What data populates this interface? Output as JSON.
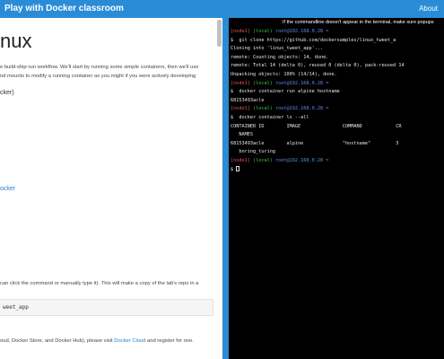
{
  "topbar": {
    "title": "Play with Docker classroom",
    "about": "About"
  },
  "lesson": {
    "heading": "nux",
    "intro_lines": [
      "e build-ship-run workflow. We'll start by running some simple containers, then we'll use",
      "nd mounts to modify a running container as you might if you were actively developing"
    ],
    "cker_text": "cker)",
    "link_docker": "ocker",
    "click_text": "can click the command or manually type it). This will make a copy of the lab's repo in a",
    "code": "weet_app",
    "cloud_text_pre": "oud, Docker Store, and Docker Hub), please visit ",
    "cloud_link": "Docker Cloud",
    "cloud_text_post": " and register for one."
  },
  "terminal": {
    "note": "If the commandline doesn't appear in the terminal, make sure popups",
    "node_label": "[node1]",
    "local_label": "(local)",
    "host": "root@192.168.0.28",
    "tilde": "~",
    "cmd_clone": "$  git clone https://github.com/dockersamples/linux_tweet_a",
    "out_cloning": "Cloning into 'linux_tweet_app'...",
    "out_counting": "remote: Counting objects: 14, done.",
    "out_total": "remote: Total 14 (delta 0), reused 0 (delta 0), pack-reused 14",
    "out_unpacking": "Unpacking objects: 100% (14/14), done.",
    "cmd_run": "$  docker container run alpine hostname",
    "out_hostname": "68153493acle",
    "cmd_ls": "$  docker container ls --all",
    "header_row": "CONTAINER ID        IMAGE               COMMAND            CR",
    "names_row": "   NAMES",
    "data_row": "68153493acle        alpine              \"hostname\"         3",
    "name_row": "   boring_turing",
    "prompt": "$ "
  }
}
